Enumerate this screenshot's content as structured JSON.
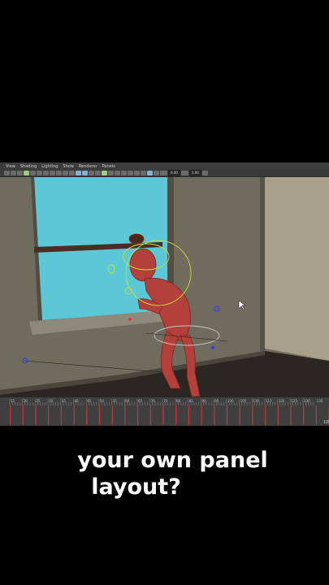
{
  "menu": {
    "items": [
      "View",
      "Shading",
      "Lighting",
      "Show",
      "Renderer",
      "Panels"
    ]
  },
  "toolbar": {
    "field_a": "0.00",
    "field_b": "1.00"
  },
  "timeline": {
    "ticks": [
      "15",
      "20",
      "25",
      "30",
      "35",
      "40",
      "45",
      "50",
      "55",
      "60",
      "65",
      "70",
      "75",
      "80",
      "85",
      "90",
      "95",
      "100",
      "105",
      "110",
      "115",
      "120",
      "125",
      "130",
      "135"
    ],
    "current_frame": "135"
  },
  "caption": {
    "line1": "your own panel",
    "line2": "layout?"
  },
  "colors": {
    "sky": "#5cc7d6",
    "character": "#b3403a",
    "wall": "#6f6c5e",
    "floor": "#2a2622",
    "control_curve": "#c8e03a"
  }
}
